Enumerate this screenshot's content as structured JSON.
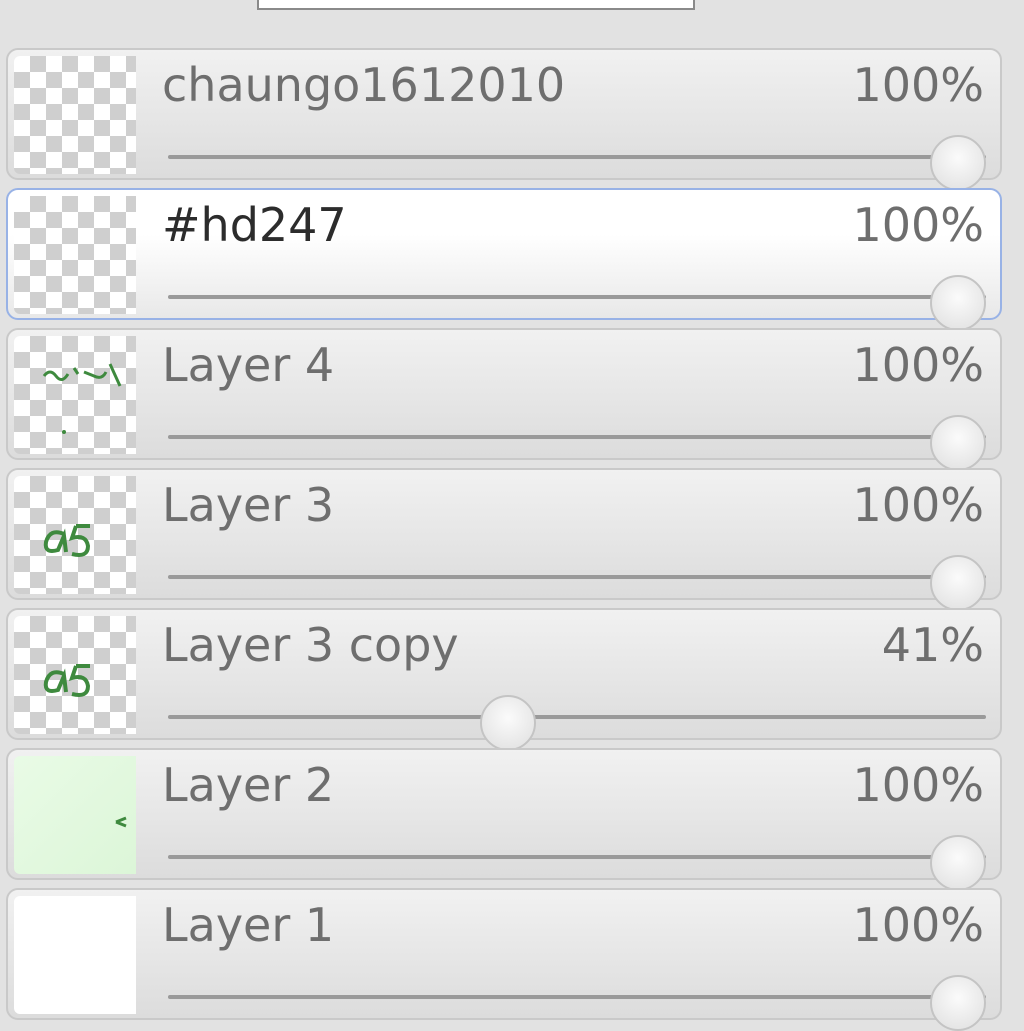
{
  "layers": [
    {
      "name": "chaungo1612010",
      "opacity_label": "100%",
      "opacity": 1.0,
      "thumb": "checker",
      "selected": false
    },
    {
      "name": "#hd247",
      "opacity_label": "100%",
      "opacity": 1.0,
      "thumb": "checker",
      "selected": true
    },
    {
      "name": "Layer 4",
      "opacity_label": "100%",
      "opacity": 1.0,
      "thumb": "checker-sketch",
      "selected": false
    },
    {
      "name": "Layer 3",
      "opacity_label": "100%",
      "opacity": 1.0,
      "thumb": "checker-a5",
      "selected": false
    },
    {
      "name": "Layer 3 copy",
      "opacity_label": "41%",
      "opacity": 0.41,
      "thumb": "checker-a5",
      "selected": false
    },
    {
      "name": "Layer 2",
      "opacity_label": "100%",
      "opacity": 1.0,
      "thumb": "green",
      "selected": false
    },
    {
      "name": "Layer 1",
      "opacity_label": "100%",
      "opacity": 1.0,
      "thumb": "white",
      "selected": false
    }
  ],
  "colors": {
    "selected_border": "#98b2e6",
    "panel_bg": "#e2e2e2",
    "thumb_ink": "#3e8a3e"
  }
}
